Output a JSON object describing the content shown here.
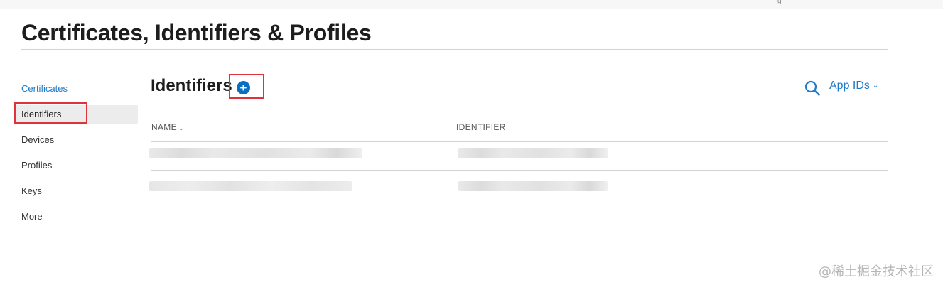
{
  "page": {
    "title": "Certificates, Identifiers & Profiles"
  },
  "sidebar": {
    "items": [
      {
        "label": "Certificates",
        "state": "link"
      },
      {
        "label": "Identifiers",
        "state": "active"
      },
      {
        "label": "Devices",
        "state": "normal"
      },
      {
        "label": "Profiles",
        "state": "normal"
      },
      {
        "label": "Keys",
        "state": "normal"
      },
      {
        "label": "More",
        "state": "normal"
      }
    ]
  },
  "main": {
    "section_title": "Identifiers",
    "add_button_symbol": "+",
    "search_icon": "search-icon",
    "filter": {
      "selected": "App IDs",
      "chevron": "⌄"
    },
    "table": {
      "columns": [
        {
          "label": "NAME",
          "sortable": true
        },
        {
          "label": "IDENTIFIER",
          "sortable": false
        }
      ],
      "rows_note": "2 rows with blurred/redacted content"
    }
  },
  "colors": {
    "accent": "#1f7ac7",
    "add_button": "#0a6fc2",
    "highlight_border": "#e0323a",
    "active_item_bg": "#ececec"
  },
  "watermark": "@稀土掘金技术社区"
}
